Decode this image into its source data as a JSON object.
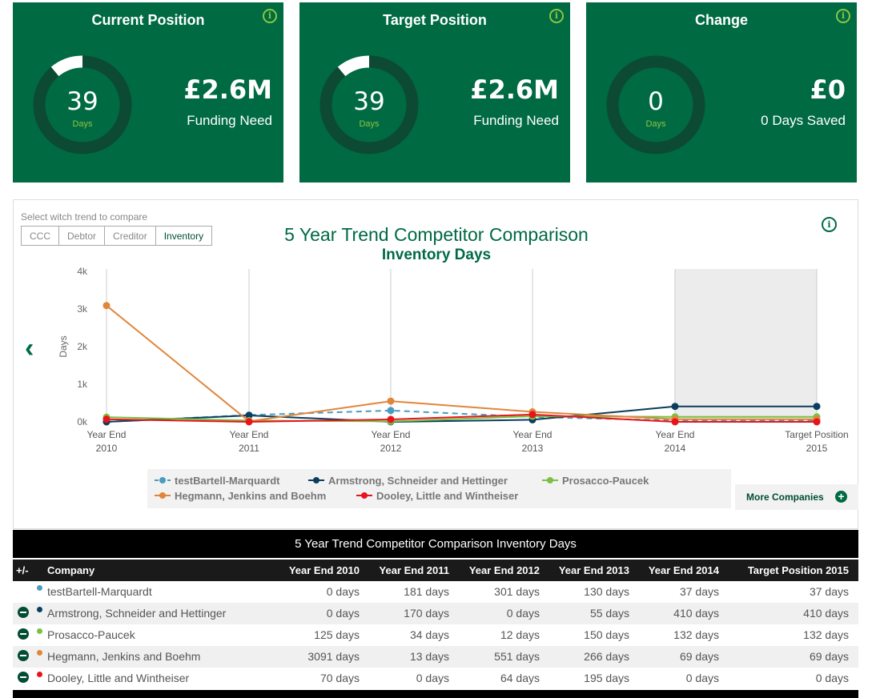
{
  "cards": [
    {
      "title": "Current Position",
      "days": "39",
      "unit": "Days",
      "value": "£2.6M",
      "label": "Funding Need",
      "arc_fraction": 0.11
    },
    {
      "title": "Target Position",
      "days": "39",
      "unit": "Days",
      "value": "£2.6M",
      "label": "Funding Need",
      "arc_fraction": 0.11
    },
    {
      "title": "Change",
      "days": "0",
      "unit": "Days",
      "value": "£0",
      "label": "0 Days Saved",
      "arc_fraction": 0
    }
  ],
  "info_glyph": "i",
  "compare": {
    "prompt": "Select witch trend to compare",
    "tabs": [
      "CCC",
      "Debtor",
      "Creditor",
      "Inventory"
    ],
    "active_tab": "Inventory"
  },
  "chart_data": {
    "type": "line",
    "title": "5 Year Trend Competitor Comparison",
    "subtitle": "Inventory Days",
    "ylabel": "Days",
    "ylim": [
      0,
      4000
    ],
    "yticks": [
      "0k",
      "1k",
      "2k",
      "3k",
      "4k"
    ],
    "categories": [
      {
        "line1": "Year End",
        "line2": "2010"
      },
      {
        "line1": "Year End",
        "line2": "2011"
      },
      {
        "line1": "Year End",
        "line2": "2012"
      },
      {
        "line1": "Year End",
        "line2": "2013"
      },
      {
        "line1": "Year End",
        "line2": "2014"
      },
      {
        "line1": "Target Position",
        "line2": "2015"
      }
    ],
    "highlight_category_index": 4,
    "grid": "vertical",
    "legend_position": "bottom",
    "series": [
      {
        "name": "testBartell-Marquardt",
        "color": "#4a9bbf",
        "dashed": true,
        "values": [
          0,
          181,
          301,
          130,
          37,
          37
        ]
      },
      {
        "name": "Armstrong, Schneider and Hettinger",
        "color": "#0a3d5e",
        "dashed": false,
        "values": [
          0,
          170,
          0,
          55,
          410,
          410
        ]
      },
      {
        "name": "Prosacco-Paucek",
        "color": "#7bc043",
        "dashed": false,
        "values": [
          125,
          34,
          12,
          150,
          132,
          132
        ]
      },
      {
        "name": "Hegmann, Jenkins and Boehm",
        "color": "#e0863a",
        "dashed": false,
        "values": [
          3091,
          13,
          551,
          266,
          69,
          69
        ]
      },
      {
        "name": "Dooley, Little and Wintheiser",
        "color": "#e8141c",
        "dashed": false,
        "values": [
          70,
          0,
          64,
          195,
          0,
          0
        ]
      }
    ]
  },
  "more_companies": "More Companies",
  "table": {
    "title": "5 Year Trend Competitor Comparison Inventory Days",
    "headers": [
      "+/-",
      "Company",
      "Year End 2010",
      "Year End 2011",
      "Year End 2012",
      "Year End 2013",
      "Year End 2014",
      "Target Position 2015"
    ],
    "rows": [
      {
        "company": "testBartell-Marquardt",
        "color": "#4a9bbf",
        "removable": false,
        "cells": [
          "0 days",
          "181 days",
          "301 days",
          "130 days",
          "37 days",
          "37 days"
        ]
      },
      {
        "company": "Armstrong, Schneider and Hettinger",
        "color": "#0a3d5e",
        "removable": true,
        "cells": [
          "0 days",
          "170 days",
          "0 days",
          "55 days",
          "410 days",
          "410 days"
        ]
      },
      {
        "company": "Prosacco-Paucek",
        "color": "#7bc043",
        "removable": true,
        "cells": [
          "125 days",
          "34 days",
          "12 days",
          "150 days",
          "132 days",
          "132 days"
        ]
      },
      {
        "company": "Hegmann, Jenkins and Boehm",
        "color": "#e0863a",
        "removable": true,
        "cells": [
          "3091 days",
          "13 days",
          "551 days",
          "266 days",
          "69 days",
          "69 days"
        ]
      },
      {
        "company": "Dooley, Little and Wintheiser",
        "color": "#e8141c",
        "removable": true,
        "cells": [
          "70 days",
          "0 days",
          "64 days",
          "195 days",
          "0 days",
          "0 days"
        ]
      }
    ]
  }
}
